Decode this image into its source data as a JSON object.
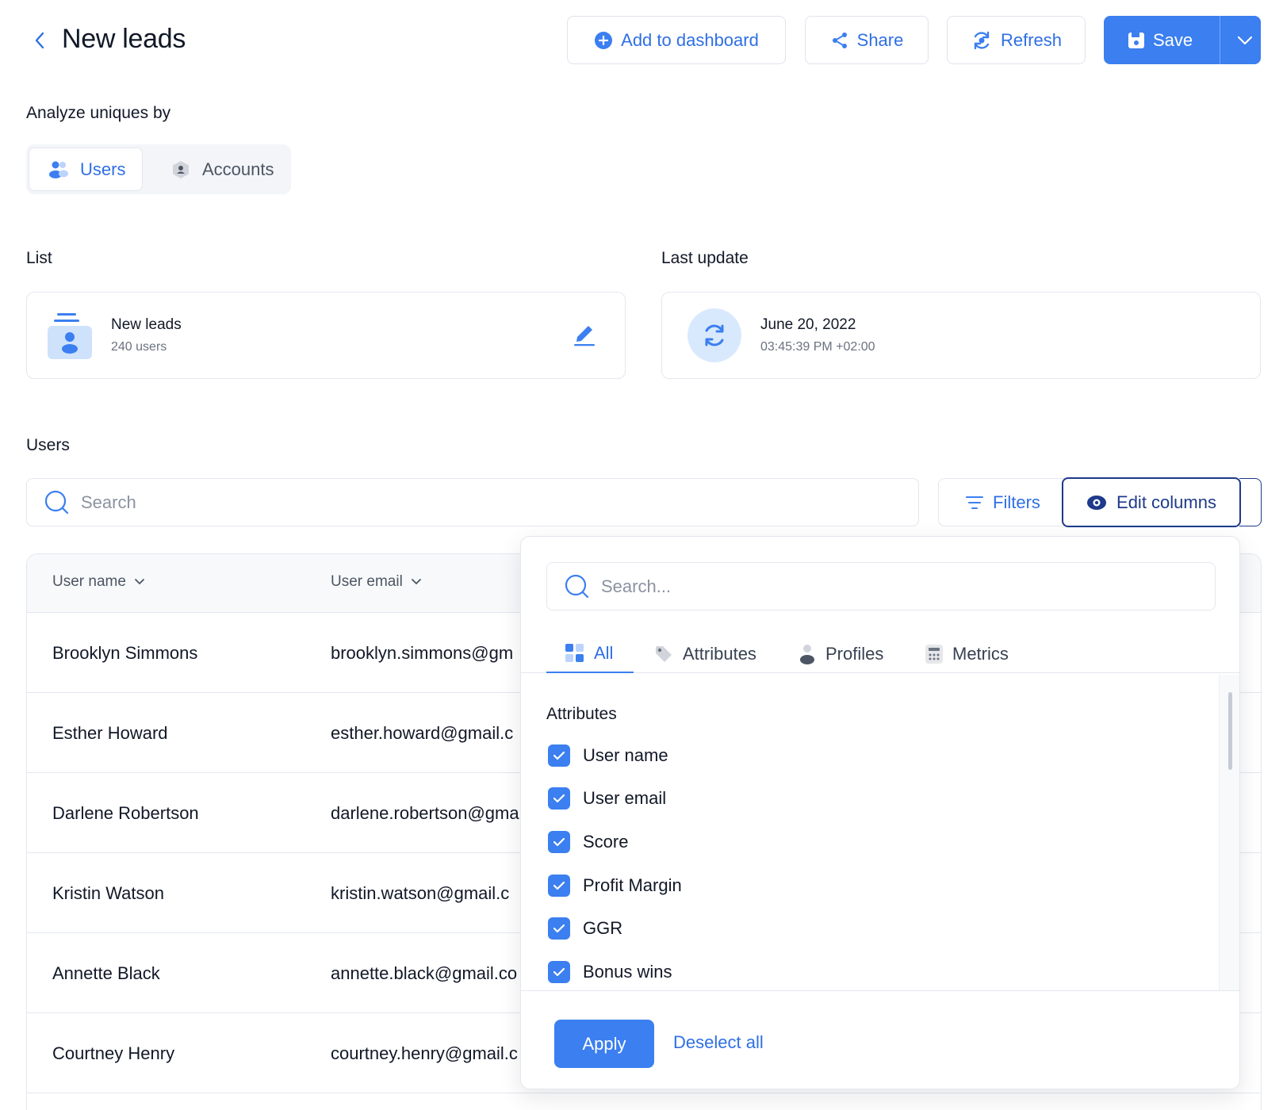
{
  "header": {
    "title": "New leads",
    "add_label": "Add to dashboard",
    "share_label": "Share",
    "refresh_label": "Refresh",
    "save_label": "Save"
  },
  "analyze": {
    "label": "Analyze uniques by",
    "options": [
      "Users",
      "Accounts"
    ],
    "selected": "Users"
  },
  "list_section": {
    "label": "List",
    "name": "New leads",
    "count": "240 users"
  },
  "update_section": {
    "label": "Last update",
    "date": "June 20, 2022",
    "time": "03:45:39 PM +02:00"
  },
  "users_section": {
    "label": "Users",
    "search_placeholder": "Search",
    "filters_label": "Filters",
    "edit_columns_label": "Edit columns"
  },
  "table": {
    "columns": [
      "User name",
      "User email"
    ],
    "rows": [
      {
        "name": "Brooklyn Simmons",
        "email": "brooklyn.simmons@gm"
      },
      {
        "name": "Esther Howard",
        "email": "esther.howard@gmail.c"
      },
      {
        "name": "Darlene Robertson",
        "email": "darlene.robertson@gma"
      },
      {
        "name": "Kristin Watson",
        "email": "kristin.watson@gmail.c"
      },
      {
        "name": "Annette Black",
        "email": "annette.black@gmail.co"
      },
      {
        "name": "Courtney Henry",
        "email": "courtney.henry@gmail.c"
      }
    ]
  },
  "popover": {
    "search_placeholder": "Search...",
    "tabs": [
      "All",
      "Attributes",
      "Profiles",
      "Metrics"
    ],
    "active_tab": "All",
    "group_title": "Attributes",
    "items": [
      {
        "label": "User name",
        "checked": true
      },
      {
        "label": "User email",
        "checked": true
      },
      {
        "label": "Score",
        "checked": true
      },
      {
        "label": "Profit Margin",
        "checked": true
      },
      {
        "label": "GGR",
        "checked": true
      },
      {
        "label": "Bonus wins",
        "checked": true
      }
    ],
    "apply_label": "Apply",
    "deselect_label": "Deselect all"
  },
  "colors": {
    "accent": "#3b7ff0",
    "link": "#2f6fe4",
    "dark_outline": "#1e3a8a",
    "border": "#e3e7ee"
  }
}
